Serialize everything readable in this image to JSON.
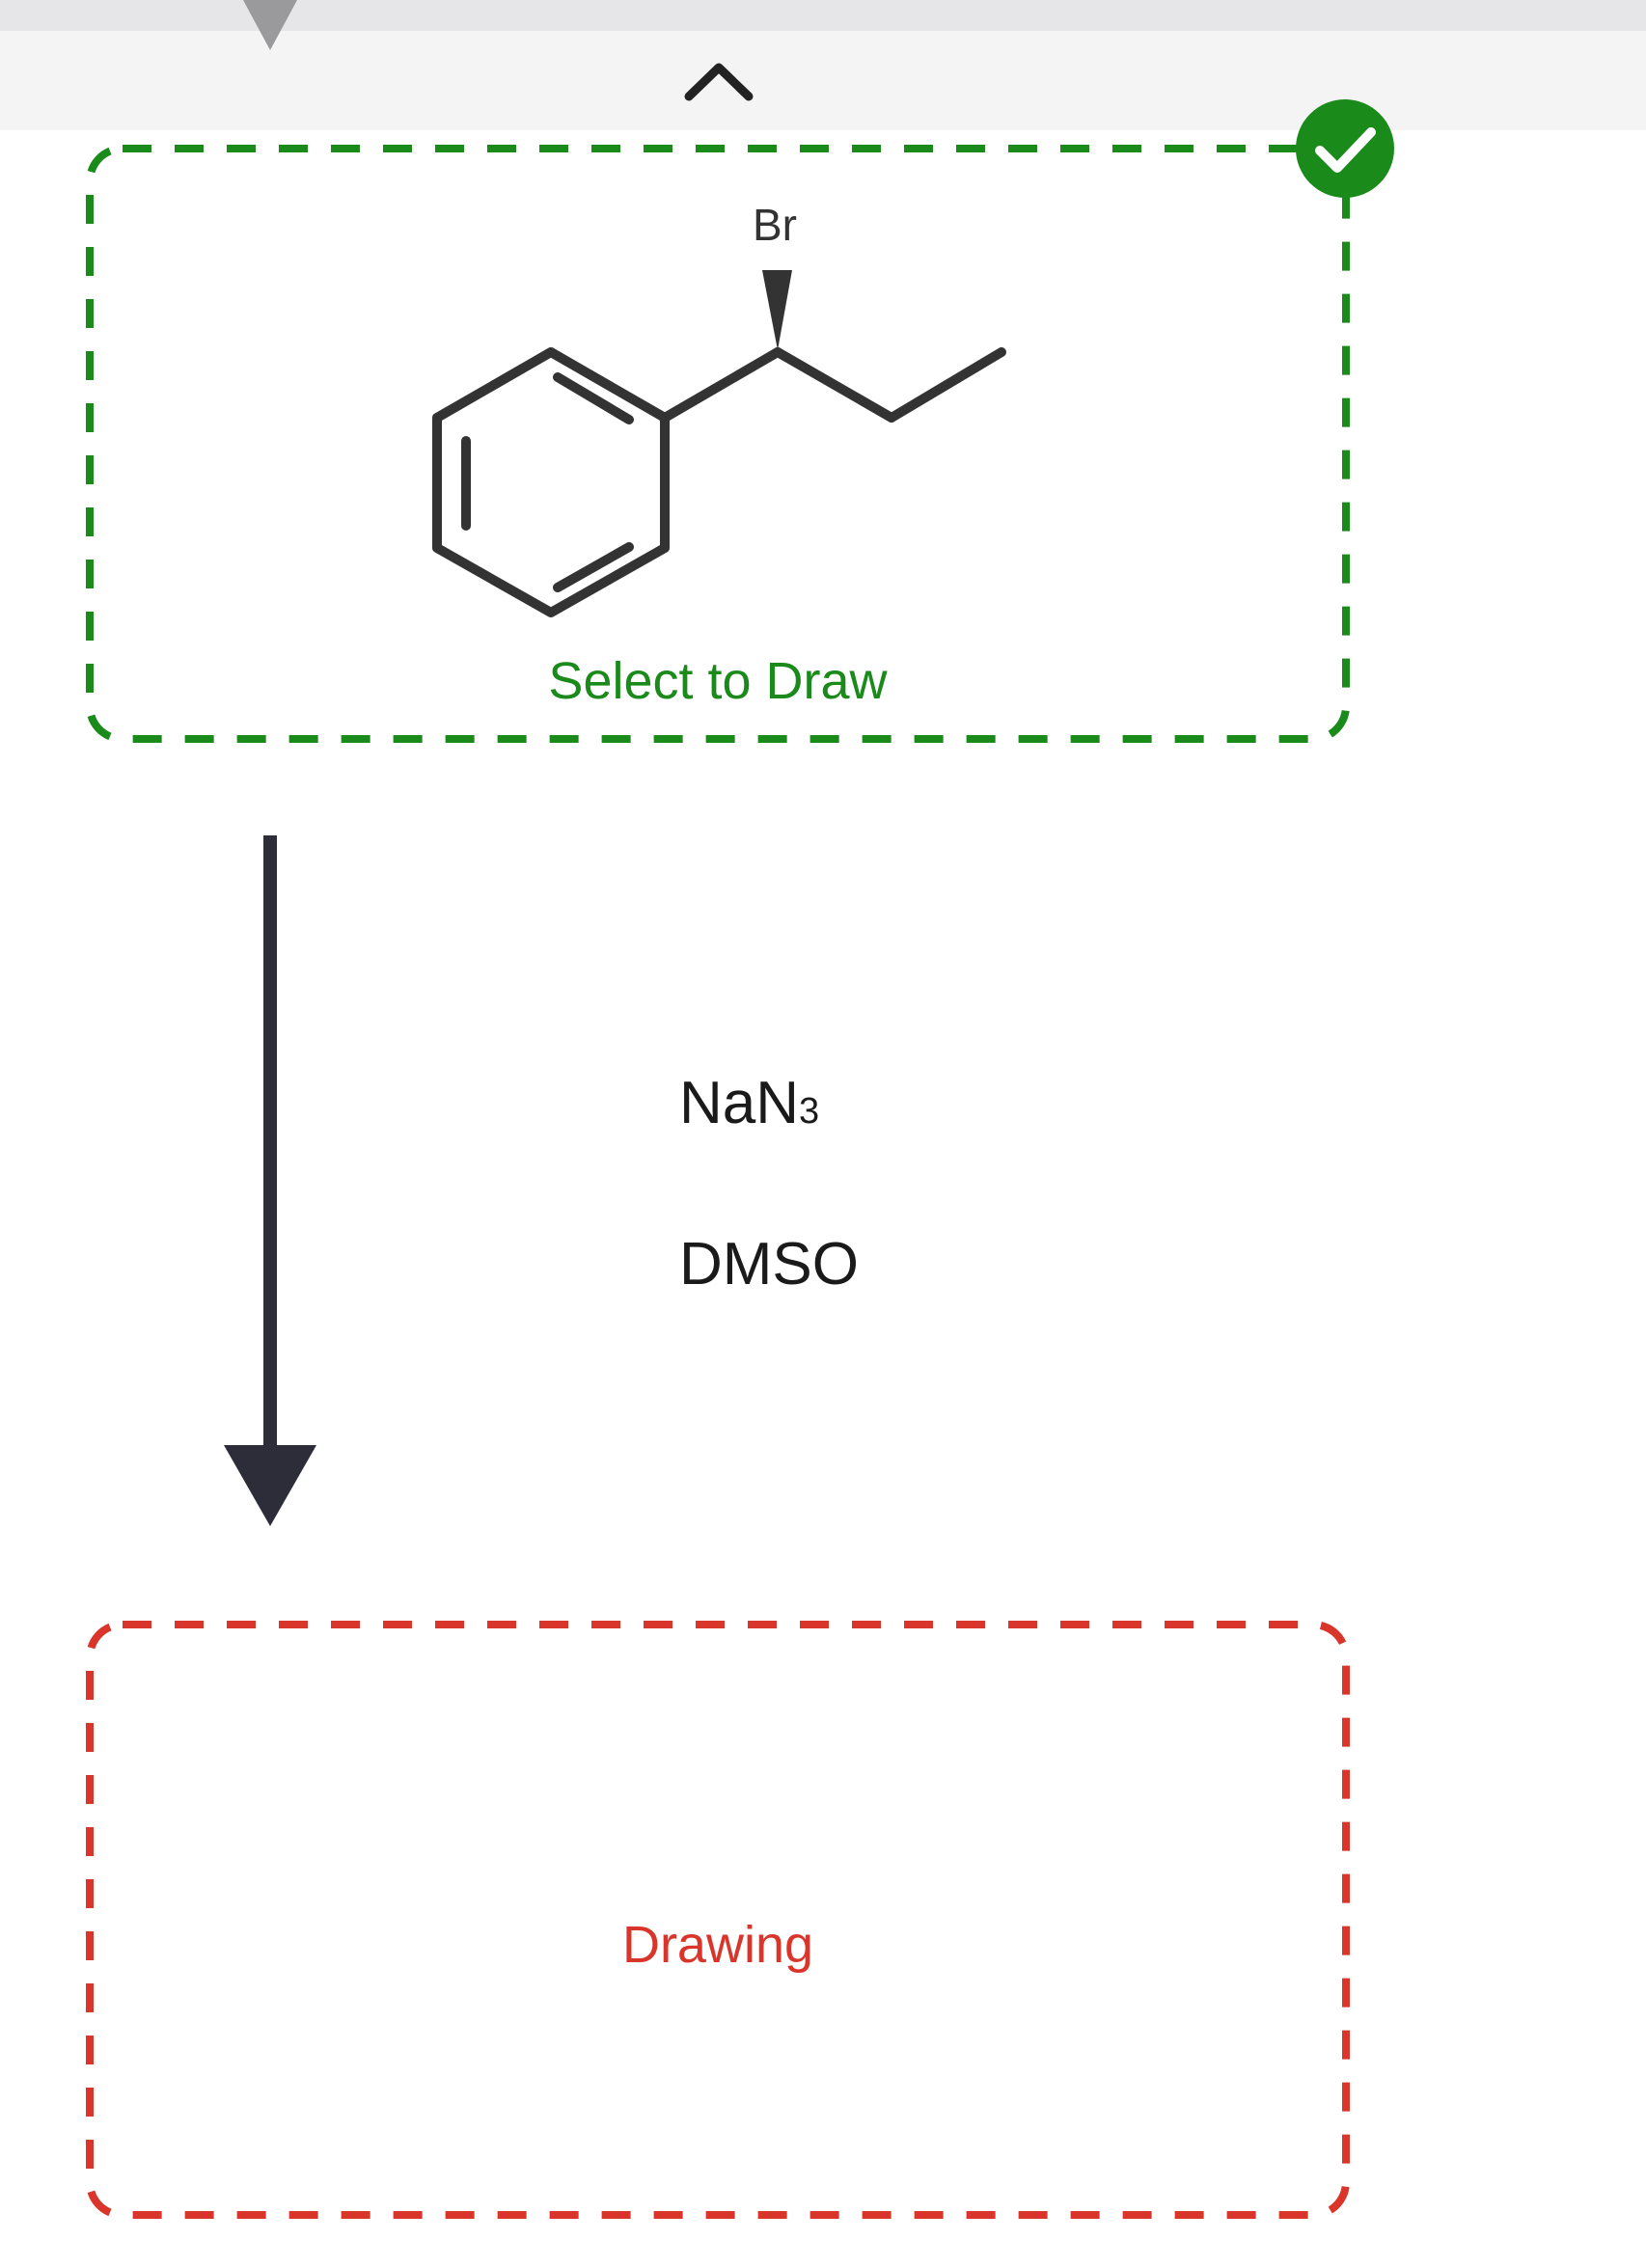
{
  "header": {
    "collapse_icon": "chevron-up-icon",
    "dropdown_indicator_icon": "triangle-down-icon"
  },
  "starting_material": {
    "atom_label": "Br",
    "action_label": "Select to Draw",
    "status_icon": "check-circle-icon",
    "accent_color": "#1a8a1a",
    "molecule": "(R)-(1-bromopropyl)benzene"
  },
  "reaction": {
    "arrow_icon": "arrow-down-icon",
    "reagent_main": "NaN",
    "reagent_sub": "3",
    "solvent": "DMSO"
  },
  "product": {
    "status_label": "Drawing",
    "accent_color": "#d9352a"
  }
}
